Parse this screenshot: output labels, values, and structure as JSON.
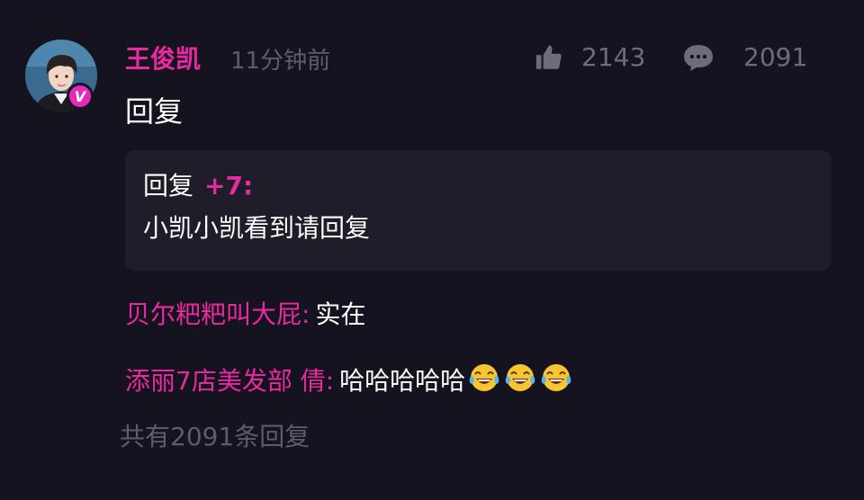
{
  "comment": {
    "username": "王俊凯",
    "timestamp": "11分钟前",
    "verified_badge": "V",
    "like_icon": "thumbs-up-icon",
    "like_count": "2143",
    "reply_icon": "speech-bubble-icon",
    "reply_count": "2091",
    "text": "回复",
    "quoted": {
      "prefix": "回复",
      "user": "+7:",
      "text": "小凯小凯看到请回复"
    },
    "replies": [
      {
        "name": "贝尔粑粑叫大屁:",
        "text": "实在"
      },
      {
        "name": "添丽7店美发部 倩:",
        "text": "哈哈哈哈哈",
        "emojis": [
          "tears-of-joy-emoji",
          "tears-of-joy-emoji",
          "tears-of-joy-emoji"
        ]
      }
    ],
    "more_replies": "共有2091条回复"
  },
  "colors": {
    "background": "#15131f",
    "accent": "#e8299f",
    "muted": "#5e5c6c",
    "quote_bg": "#1f1d29"
  }
}
